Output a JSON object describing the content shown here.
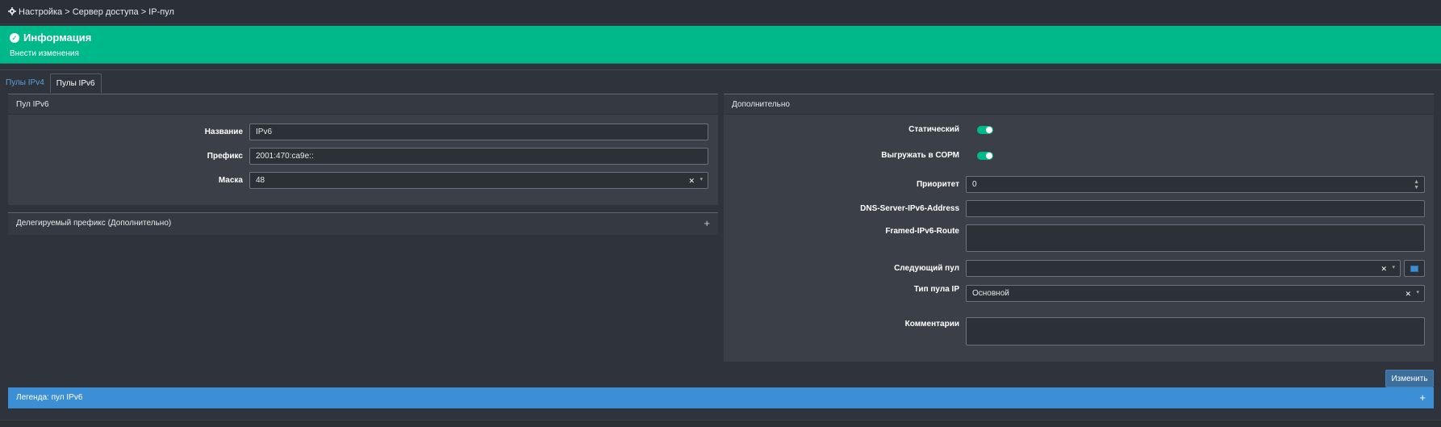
{
  "breadcrumb": "Настройка > Сервер доступа > IP-пул",
  "info": {
    "title": "Информация",
    "message": "Внести изменения"
  },
  "tabs": [
    {
      "label": "Пулы IPv4"
    },
    {
      "label": "Пулы IPv6"
    }
  ],
  "pool_panel": {
    "header": "Пул IPv6",
    "name_label": "Название",
    "name_value": "IPv6",
    "prefix_label": "Префикс",
    "prefix_value": "2001:470:ca9e::",
    "mask_label": "Маска",
    "mask_value": "48"
  },
  "delegated_panel": {
    "header": "Делегируемый префикс (Дополнительно)"
  },
  "extra_panel": {
    "header": "Дополнительно",
    "static_label": "Статический",
    "export_label": "Выгружать в СОРМ",
    "priority_label": "Приоритет",
    "priority_value": "0",
    "dns_label": "DNS-Server-IPv6-Address",
    "dns_value": "",
    "route_label": "Framed-IPv6-Route",
    "route_value": "",
    "next_pool_label": "Следующий пул",
    "next_pool_value": "",
    "pool_type_label": "Тип пула IP",
    "pool_type_value": "Основной",
    "comment_label": "Комментарии",
    "comment_value": ""
  },
  "actions": {
    "change_label": "Изменить"
  },
  "legend": {
    "label": "Легенда: пул IPv6"
  },
  "colors": {
    "accent_green": "#00b98b",
    "accent_blue": "#3d8fd5"
  }
}
